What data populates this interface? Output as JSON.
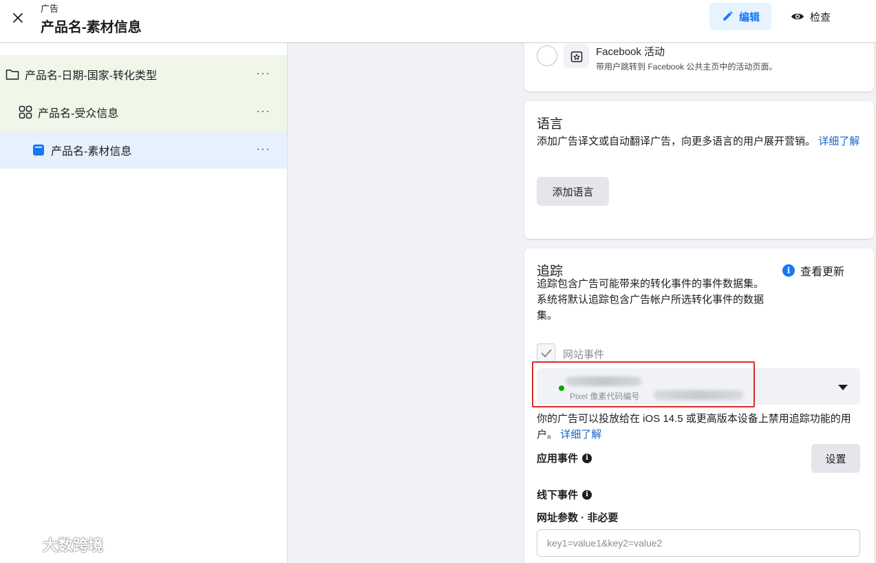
{
  "header": {
    "subtitle": "广告",
    "title": "产品名-素材信息",
    "edit_label": "编辑",
    "review_label": "检查"
  },
  "sidebar": {
    "items": [
      {
        "label": "产品名-日期-国家-转化类型",
        "icon": "folder-icon",
        "more": "···"
      },
      {
        "label": "产品名-受众信息",
        "icon": "grid-icon",
        "more": "···"
      },
      {
        "label": "产品名-素材信息",
        "icon": "ad-icon",
        "more": "···"
      }
    ]
  },
  "watermark": {
    "text": "大数跨境"
  },
  "destination_option": {
    "title": "Facebook 活动",
    "description": "带用户跳转到 Facebook 公共主页中的活动页面。"
  },
  "language": {
    "heading": "语言",
    "description": "添加广告译文或自动翻译广告，向更多语言的用户展开营销。",
    "learn_more": "详细了解",
    "add_button": "添加语言"
  },
  "tracking": {
    "heading": "追踪",
    "description": "追踪包含广告可能带来的转化事件的事件数据集。系统将默认追踪包含广告帐户所选转化事件的数据集。",
    "updates_link": "查看更新",
    "website_events_label": "网站事件",
    "pixel_id_label": "Pixel 像素代码编号",
    "ios_note": "你的广告可以投放给在 iOS 14.5 或更高版本设备上禁用追踪功能的用户。",
    "ios_learn_more": "详细了解",
    "app_events_label": "应用事件",
    "setup_button": "设置",
    "offline_events_label": "线下事件",
    "url_params_label": "网址参数",
    "url_params_optional": " · 非必要",
    "url_params_placeholder": "key1=value1&key2=value2"
  }
}
